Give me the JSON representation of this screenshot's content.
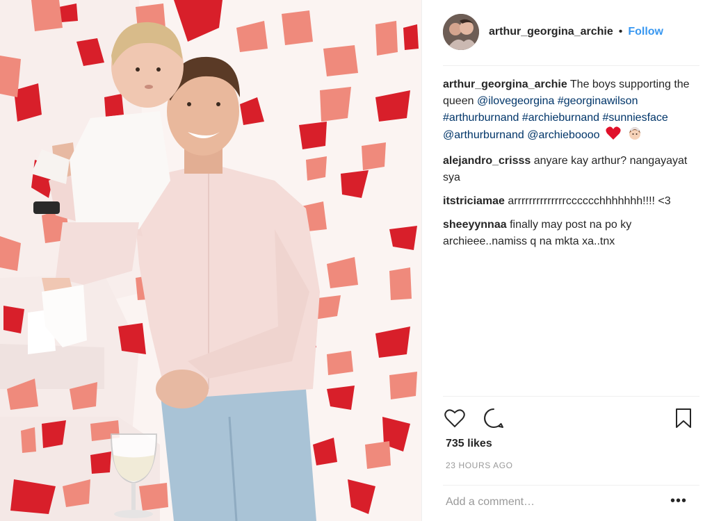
{
  "post": {
    "username": "arthur_georgina_archie",
    "separator": "•",
    "follow_label": "Follow",
    "caption": {
      "username": "arthur_georgina_archie",
      "text": "The boys supporting the queen",
      "mentions": [
        "@ilovegeorgina",
        "#georginawilson",
        "#arthurburnand",
        "#archieburnand",
        "#sunniesface",
        "@arthurburnand",
        "@archieboooo"
      ]
    },
    "comments": [
      {
        "username": "alejandro_crisss",
        "text": "anyare kay arthur? nangayayat sya"
      },
      {
        "username": "itstriciamae",
        "text": "arrrrrrrrrrrrrrcccccchhhhhhh!!!! <3"
      },
      {
        "username": "sheeyynnaa",
        "text": "finally may post na po ky archieee..namiss q na mkta xa..tnx"
      }
    ],
    "likes": "735 likes",
    "timestamp": "23 HOURS AGO",
    "add_comment_placeholder": "Add a comment…",
    "more_label": "•••"
  },
  "icons": {
    "like": "heart-outline-icon",
    "comment": "speech-bubble-icon",
    "save": "bookmark-icon",
    "options": "ellipsis-icon"
  },
  "colors": {
    "link": "#003569",
    "follow": "#3897f0",
    "muted": "#999999",
    "text": "#262626",
    "heart_emoji": "#e0102a"
  }
}
